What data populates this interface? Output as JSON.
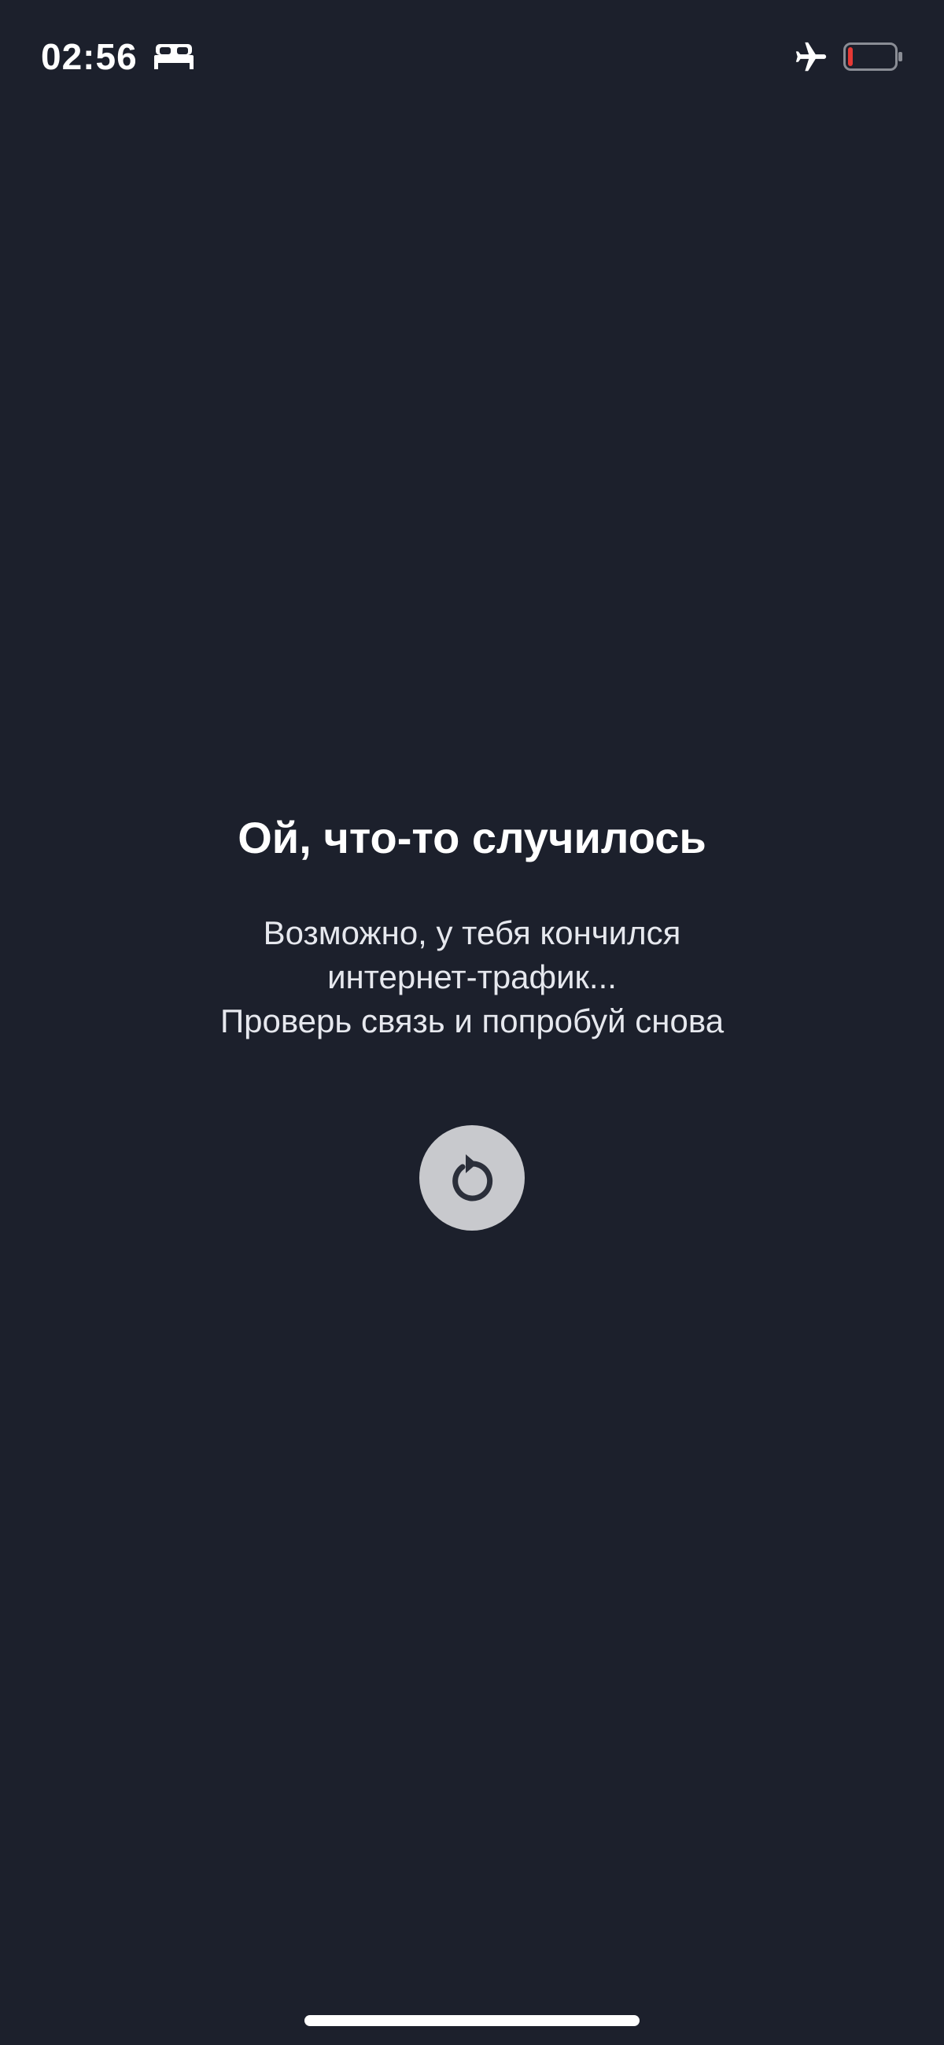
{
  "status_bar": {
    "time": "02:56",
    "icons": {
      "sleep": "bed-icon",
      "airplane": "airplane-icon",
      "battery": "battery-icon"
    },
    "battery_level": 0.1,
    "battery_color": "#e53935"
  },
  "error": {
    "title": "Ой, что-то случилось",
    "message_lines": [
      "Возможно, у тебя кончился",
      "интернет-трафик...",
      "Проверь связь и попробуй снова"
    ]
  },
  "retry": {
    "icon": "retry-icon"
  },
  "colors": {
    "background": "#1c202c",
    "button": "#c8c9cd",
    "icon_dark": "#2b2f3a"
  }
}
